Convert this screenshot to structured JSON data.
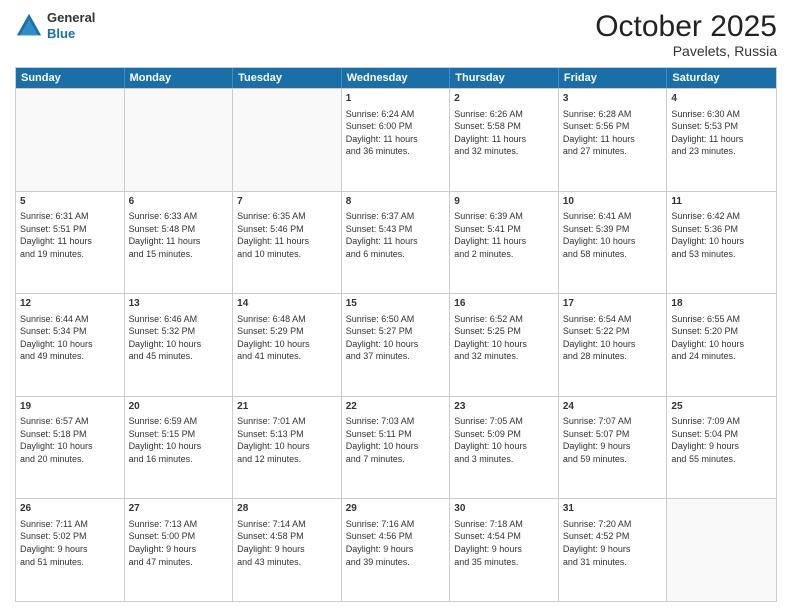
{
  "header": {
    "logo": {
      "line1": "General",
      "line2": "Blue"
    },
    "title": "October 2025",
    "location": "Pavelets, Russia"
  },
  "days": [
    "Sunday",
    "Monday",
    "Tuesday",
    "Wednesday",
    "Thursday",
    "Friday",
    "Saturday"
  ],
  "weeks": [
    [
      {
        "num": "",
        "lines": []
      },
      {
        "num": "",
        "lines": []
      },
      {
        "num": "",
        "lines": []
      },
      {
        "num": "1",
        "lines": [
          "Sunrise: 6:24 AM",
          "Sunset: 6:00 PM",
          "Daylight: 11 hours",
          "and 36 minutes."
        ]
      },
      {
        "num": "2",
        "lines": [
          "Sunrise: 6:26 AM",
          "Sunset: 5:58 PM",
          "Daylight: 11 hours",
          "and 32 minutes."
        ]
      },
      {
        "num": "3",
        "lines": [
          "Sunrise: 6:28 AM",
          "Sunset: 5:56 PM",
          "Daylight: 11 hours",
          "and 27 minutes."
        ]
      },
      {
        "num": "4",
        "lines": [
          "Sunrise: 6:30 AM",
          "Sunset: 5:53 PM",
          "Daylight: 11 hours",
          "and 23 minutes."
        ]
      }
    ],
    [
      {
        "num": "5",
        "lines": [
          "Sunrise: 6:31 AM",
          "Sunset: 5:51 PM",
          "Daylight: 11 hours",
          "and 19 minutes."
        ]
      },
      {
        "num": "6",
        "lines": [
          "Sunrise: 6:33 AM",
          "Sunset: 5:48 PM",
          "Daylight: 11 hours",
          "and 15 minutes."
        ]
      },
      {
        "num": "7",
        "lines": [
          "Sunrise: 6:35 AM",
          "Sunset: 5:46 PM",
          "Daylight: 11 hours",
          "and 10 minutes."
        ]
      },
      {
        "num": "8",
        "lines": [
          "Sunrise: 6:37 AM",
          "Sunset: 5:43 PM",
          "Daylight: 11 hours",
          "and 6 minutes."
        ]
      },
      {
        "num": "9",
        "lines": [
          "Sunrise: 6:39 AM",
          "Sunset: 5:41 PM",
          "Daylight: 11 hours",
          "and 2 minutes."
        ]
      },
      {
        "num": "10",
        "lines": [
          "Sunrise: 6:41 AM",
          "Sunset: 5:39 PM",
          "Daylight: 10 hours",
          "and 58 minutes."
        ]
      },
      {
        "num": "11",
        "lines": [
          "Sunrise: 6:42 AM",
          "Sunset: 5:36 PM",
          "Daylight: 10 hours",
          "and 53 minutes."
        ]
      }
    ],
    [
      {
        "num": "12",
        "lines": [
          "Sunrise: 6:44 AM",
          "Sunset: 5:34 PM",
          "Daylight: 10 hours",
          "and 49 minutes."
        ]
      },
      {
        "num": "13",
        "lines": [
          "Sunrise: 6:46 AM",
          "Sunset: 5:32 PM",
          "Daylight: 10 hours",
          "and 45 minutes."
        ]
      },
      {
        "num": "14",
        "lines": [
          "Sunrise: 6:48 AM",
          "Sunset: 5:29 PM",
          "Daylight: 10 hours",
          "and 41 minutes."
        ]
      },
      {
        "num": "15",
        "lines": [
          "Sunrise: 6:50 AM",
          "Sunset: 5:27 PM",
          "Daylight: 10 hours",
          "and 37 minutes."
        ]
      },
      {
        "num": "16",
        "lines": [
          "Sunrise: 6:52 AM",
          "Sunset: 5:25 PM",
          "Daylight: 10 hours",
          "and 32 minutes."
        ]
      },
      {
        "num": "17",
        "lines": [
          "Sunrise: 6:54 AM",
          "Sunset: 5:22 PM",
          "Daylight: 10 hours",
          "and 28 minutes."
        ]
      },
      {
        "num": "18",
        "lines": [
          "Sunrise: 6:55 AM",
          "Sunset: 5:20 PM",
          "Daylight: 10 hours",
          "and 24 minutes."
        ]
      }
    ],
    [
      {
        "num": "19",
        "lines": [
          "Sunrise: 6:57 AM",
          "Sunset: 5:18 PM",
          "Daylight: 10 hours",
          "and 20 minutes."
        ]
      },
      {
        "num": "20",
        "lines": [
          "Sunrise: 6:59 AM",
          "Sunset: 5:15 PM",
          "Daylight: 10 hours",
          "and 16 minutes."
        ]
      },
      {
        "num": "21",
        "lines": [
          "Sunrise: 7:01 AM",
          "Sunset: 5:13 PM",
          "Daylight: 10 hours",
          "and 12 minutes."
        ]
      },
      {
        "num": "22",
        "lines": [
          "Sunrise: 7:03 AM",
          "Sunset: 5:11 PM",
          "Daylight: 10 hours",
          "and 7 minutes."
        ]
      },
      {
        "num": "23",
        "lines": [
          "Sunrise: 7:05 AM",
          "Sunset: 5:09 PM",
          "Daylight: 10 hours",
          "and 3 minutes."
        ]
      },
      {
        "num": "24",
        "lines": [
          "Sunrise: 7:07 AM",
          "Sunset: 5:07 PM",
          "Daylight: 9 hours",
          "and 59 minutes."
        ]
      },
      {
        "num": "25",
        "lines": [
          "Sunrise: 7:09 AM",
          "Sunset: 5:04 PM",
          "Daylight: 9 hours",
          "and 55 minutes."
        ]
      }
    ],
    [
      {
        "num": "26",
        "lines": [
          "Sunrise: 7:11 AM",
          "Sunset: 5:02 PM",
          "Daylight: 9 hours",
          "and 51 minutes."
        ]
      },
      {
        "num": "27",
        "lines": [
          "Sunrise: 7:13 AM",
          "Sunset: 5:00 PM",
          "Daylight: 9 hours",
          "and 47 minutes."
        ]
      },
      {
        "num": "28",
        "lines": [
          "Sunrise: 7:14 AM",
          "Sunset: 4:58 PM",
          "Daylight: 9 hours",
          "and 43 minutes."
        ]
      },
      {
        "num": "29",
        "lines": [
          "Sunrise: 7:16 AM",
          "Sunset: 4:56 PM",
          "Daylight: 9 hours",
          "and 39 minutes."
        ]
      },
      {
        "num": "30",
        "lines": [
          "Sunrise: 7:18 AM",
          "Sunset: 4:54 PM",
          "Daylight: 9 hours",
          "and 35 minutes."
        ]
      },
      {
        "num": "31",
        "lines": [
          "Sunrise: 7:20 AM",
          "Sunset: 4:52 PM",
          "Daylight: 9 hours",
          "and 31 minutes."
        ]
      },
      {
        "num": "",
        "lines": []
      }
    ]
  ]
}
